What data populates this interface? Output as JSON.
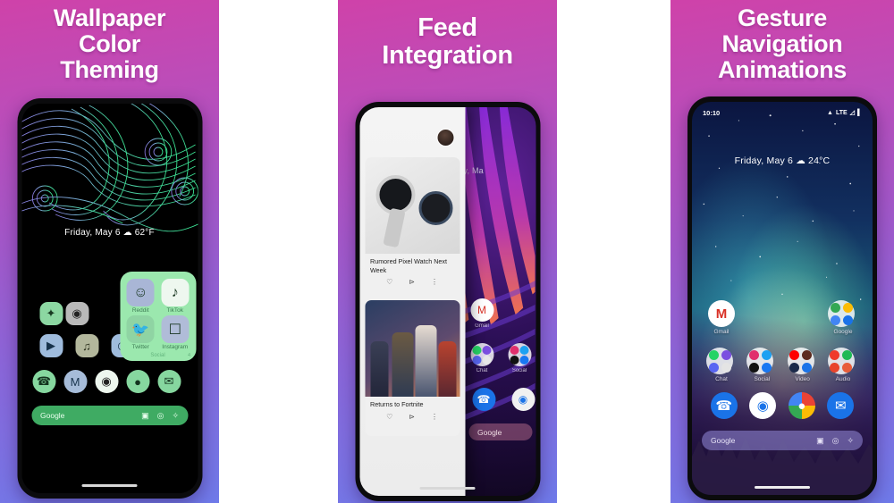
{
  "theme": {
    "gradient_top": "#cf42a9",
    "gradient_bottom": "#6f7ae9",
    "headline_color": "#ffffff"
  },
  "panels": [
    {
      "id": "wallpaper-color-theming",
      "headline": "Wallpaper\nColor\nTheming",
      "headline_lines": [
        "Wallpaper",
        "Color",
        "Theming"
      ],
      "phone": {
        "wallpaper": "swirl-line-art-purple-green",
        "date_widget": "Friday, May 6",
        "weather_icon": "cloud-icon",
        "temperature": "62°F",
        "folder": {
          "title": "Social",
          "count": "4",
          "apps": [
            {
              "label": "Reddit",
              "icon": "reddit-icon"
            },
            {
              "label": "TikTok",
              "icon": "tiktok-icon"
            },
            {
              "label": "Twitter",
              "icon": "twitter-icon"
            },
            {
              "label": "Instagram",
              "icon": "instagram-icon"
            }
          ]
        },
        "row1": [
          {
            "icon": "plex-icon"
          },
          {
            "icon": "camera-icon"
          }
        ],
        "row2": [
          {
            "icon": "youtube-icon"
          },
          {
            "icon": "spotify-icon"
          },
          {
            "icon": "app-icon"
          }
        ],
        "dock": [
          {
            "icon": "phone-icon"
          },
          {
            "icon": "gmail-icon"
          },
          {
            "icon": "chrome-icon"
          },
          {
            "icon": "maps-icon"
          },
          {
            "icon": "messages-icon"
          }
        ],
        "search": {
          "label": "Google",
          "actions": [
            "camera-icon",
            "lens-icon",
            "assistant-icon"
          ]
        }
      }
    },
    {
      "id": "feed-integration",
      "headline_lines": [
        "Feed",
        "Integration"
      ],
      "phone": {
        "wallpaper": "purple-fronds",
        "date_widget": "Friday, Ma",
        "feed": {
          "avatar": "user-avatar",
          "cards": [
            {
              "title": "Rumored Pixel Watch Next Week",
              "image": "pixel-watch-photo",
              "actions": [
                "heart-icon",
                "share-icon",
                "more-icon"
              ]
            },
            {
              "title": "Returns to Fortnite",
              "image": "fortnite-characters-photo",
              "actions": [
                "heart-icon",
                "share-icon",
                "more-icon"
              ]
            }
          ]
        },
        "apps": [
          {
            "label": "Gmail",
            "icon": "gmail-icon"
          }
        ],
        "folders": [
          {
            "label": "Chat",
            "icon": "chat-folder-icon"
          },
          {
            "label": "Social",
            "icon": "social-folder-icon"
          }
        ],
        "dock": [
          {
            "icon": "phone-icon"
          },
          {
            "icon": "camera-icon"
          }
        ],
        "search": {
          "label": "Google"
        }
      }
    },
    {
      "id": "gesture-navigation-animations",
      "headline_lines": [
        "Gesture",
        "Navigation",
        "Animations"
      ],
      "phone": {
        "wallpaper": "aurora-forest",
        "status_bar": {
          "time": "10:10",
          "icons": [
            "wifi-icon",
            "lte-label",
            "signal-icon",
            "battery-icon"
          ],
          "network": "LTE"
        },
        "date_widget": "Friday, May 6",
        "weather_icon": "cloud-icon",
        "temperature": "24°C",
        "row1": [
          {
            "label": "Gmail",
            "icon": "gmail-icon"
          },
          {
            "label": "Google",
            "icon": "google-folder-icon"
          }
        ],
        "row2": [
          {
            "label": "Chat",
            "icon": "chat-folder-icon"
          },
          {
            "label": "Social",
            "icon": "social-folder-icon"
          },
          {
            "label": "Video",
            "icon": "video-folder-icon"
          },
          {
            "label": "Audio",
            "icon": "audio-folder-icon"
          }
        ],
        "dock": [
          {
            "icon": "phone-icon"
          },
          {
            "icon": "camera-icon"
          },
          {
            "icon": "chrome-icon"
          },
          {
            "icon": "messages-icon"
          }
        ],
        "search": {
          "label": "Google",
          "actions": [
            "camera-icon",
            "lens-icon",
            "assistant-icon"
          ]
        }
      }
    }
  ]
}
